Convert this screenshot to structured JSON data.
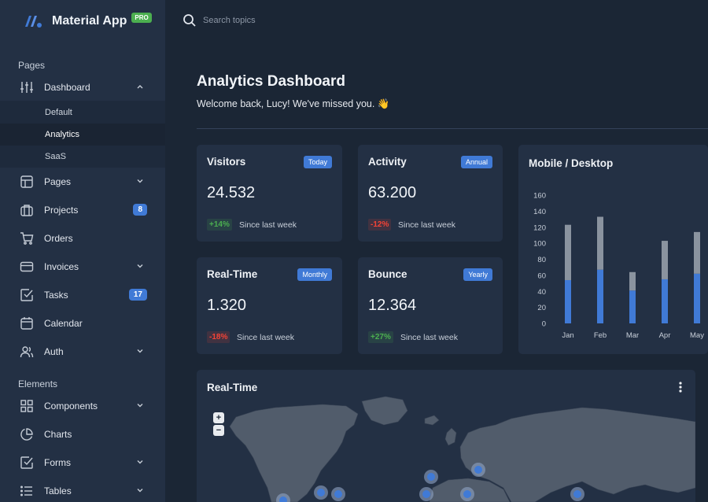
{
  "brand": {
    "name": "Material App",
    "badge": "PRO"
  },
  "search": {
    "placeholder": "Search topics"
  },
  "sidebar": {
    "sections": [
      "Pages",
      "Elements"
    ],
    "items": [
      {
        "label": "Dashboard",
        "icon": "sliders-icon"
      },
      {
        "label": "Pages",
        "icon": "layout-icon"
      },
      {
        "label": "Projects",
        "icon": "briefcase-icon",
        "count": "8"
      },
      {
        "label": "Orders",
        "icon": "cart-icon"
      },
      {
        "label": "Invoices",
        "icon": "card-icon"
      },
      {
        "label": "Tasks",
        "icon": "checkbox-icon",
        "count": "17"
      },
      {
        "label": "Calendar",
        "icon": "calendar-icon"
      },
      {
        "label": "Auth",
        "icon": "users-icon"
      },
      {
        "label": "Components",
        "icon": "grid-icon"
      },
      {
        "label": "Charts",
        "icon": "piechart-icon"
      },
      {
        "label": "Forms",
        "icon": "checkbox-icon"
      },
      {
        "label": "Tables",
        "icon": "list-icon"
      }
    ],
    "dashboard_sub": [
      "Default",
      "Analytics",
      "SaaS"
    ],
    "active_sub": "Analytics"
  },
  "page": {
    "title": "Analytics Dashboard",
    "subtitle": "Welcome back, Lucy! We've missed you. 👋"
  },
  "stats": [
    {
      "title": "Visitors",
      "badge": "Today",
      "value": "24.532",
      "change": "+14%",
      "trend": "pos",
      "since": "Since last week"
    },
    {
      "title": "Activity",
      "badge": "Annual",
      "value": "63.200",
      "change": "-12%",
      "trend": "neg",
      "since": "Since last week"
    },
    {
      "title": "Real-Time",
      "badge": "Monthly",
      "value": "1.320",
      "change": "-18%",
      "trend": "neg",
      "since": "Since last week"
    },
    {
      "title": "Bounce",
      "badge": "Yearly",
      "value": "12.364",
      "change": "+27%",
      "trend": "pos",
      "since": "Since last week"
    }
  ],
  "mobile_desktop": {
    "title": "Mobile / Desktop"
  },
  "chart_data": {
    "type": "bar",
    "stacked": true,
    "title": "Mobile / Desktop",
    "categories": [
      "Jan",
      "Feb",
      "Mar",
      "Apr",
      "May"
    ],
    "series": [
      {
        "values": [
          54,
          67,
          41,
          55,
          62
        ],
        "color": "#407ad6"
      },
      {
        "values": [
          69,
          66,
          23,
          48,
          52
        ],
        "color": "#8a939f"
      }
    ],
    "ylim": [
      0,
      160
    ],
    "yticks": [
      0,
      20,
      40,
      60,
      80,
      100,
      120,
      140,
      160
    ],
    "grid": false,
    "legend": "none"
  },
  "realtime_map": {
    "title": "Real-Time",
    "zoom_in": "+",
    "zoom_out": "−"
  },
  "colors": {
    "accent": "#407ad6",
    "positive": "#4caf50",
    "negative": "#f44336",
    "background": "#1b2635",
    "panel": "#233044"
  }
}
